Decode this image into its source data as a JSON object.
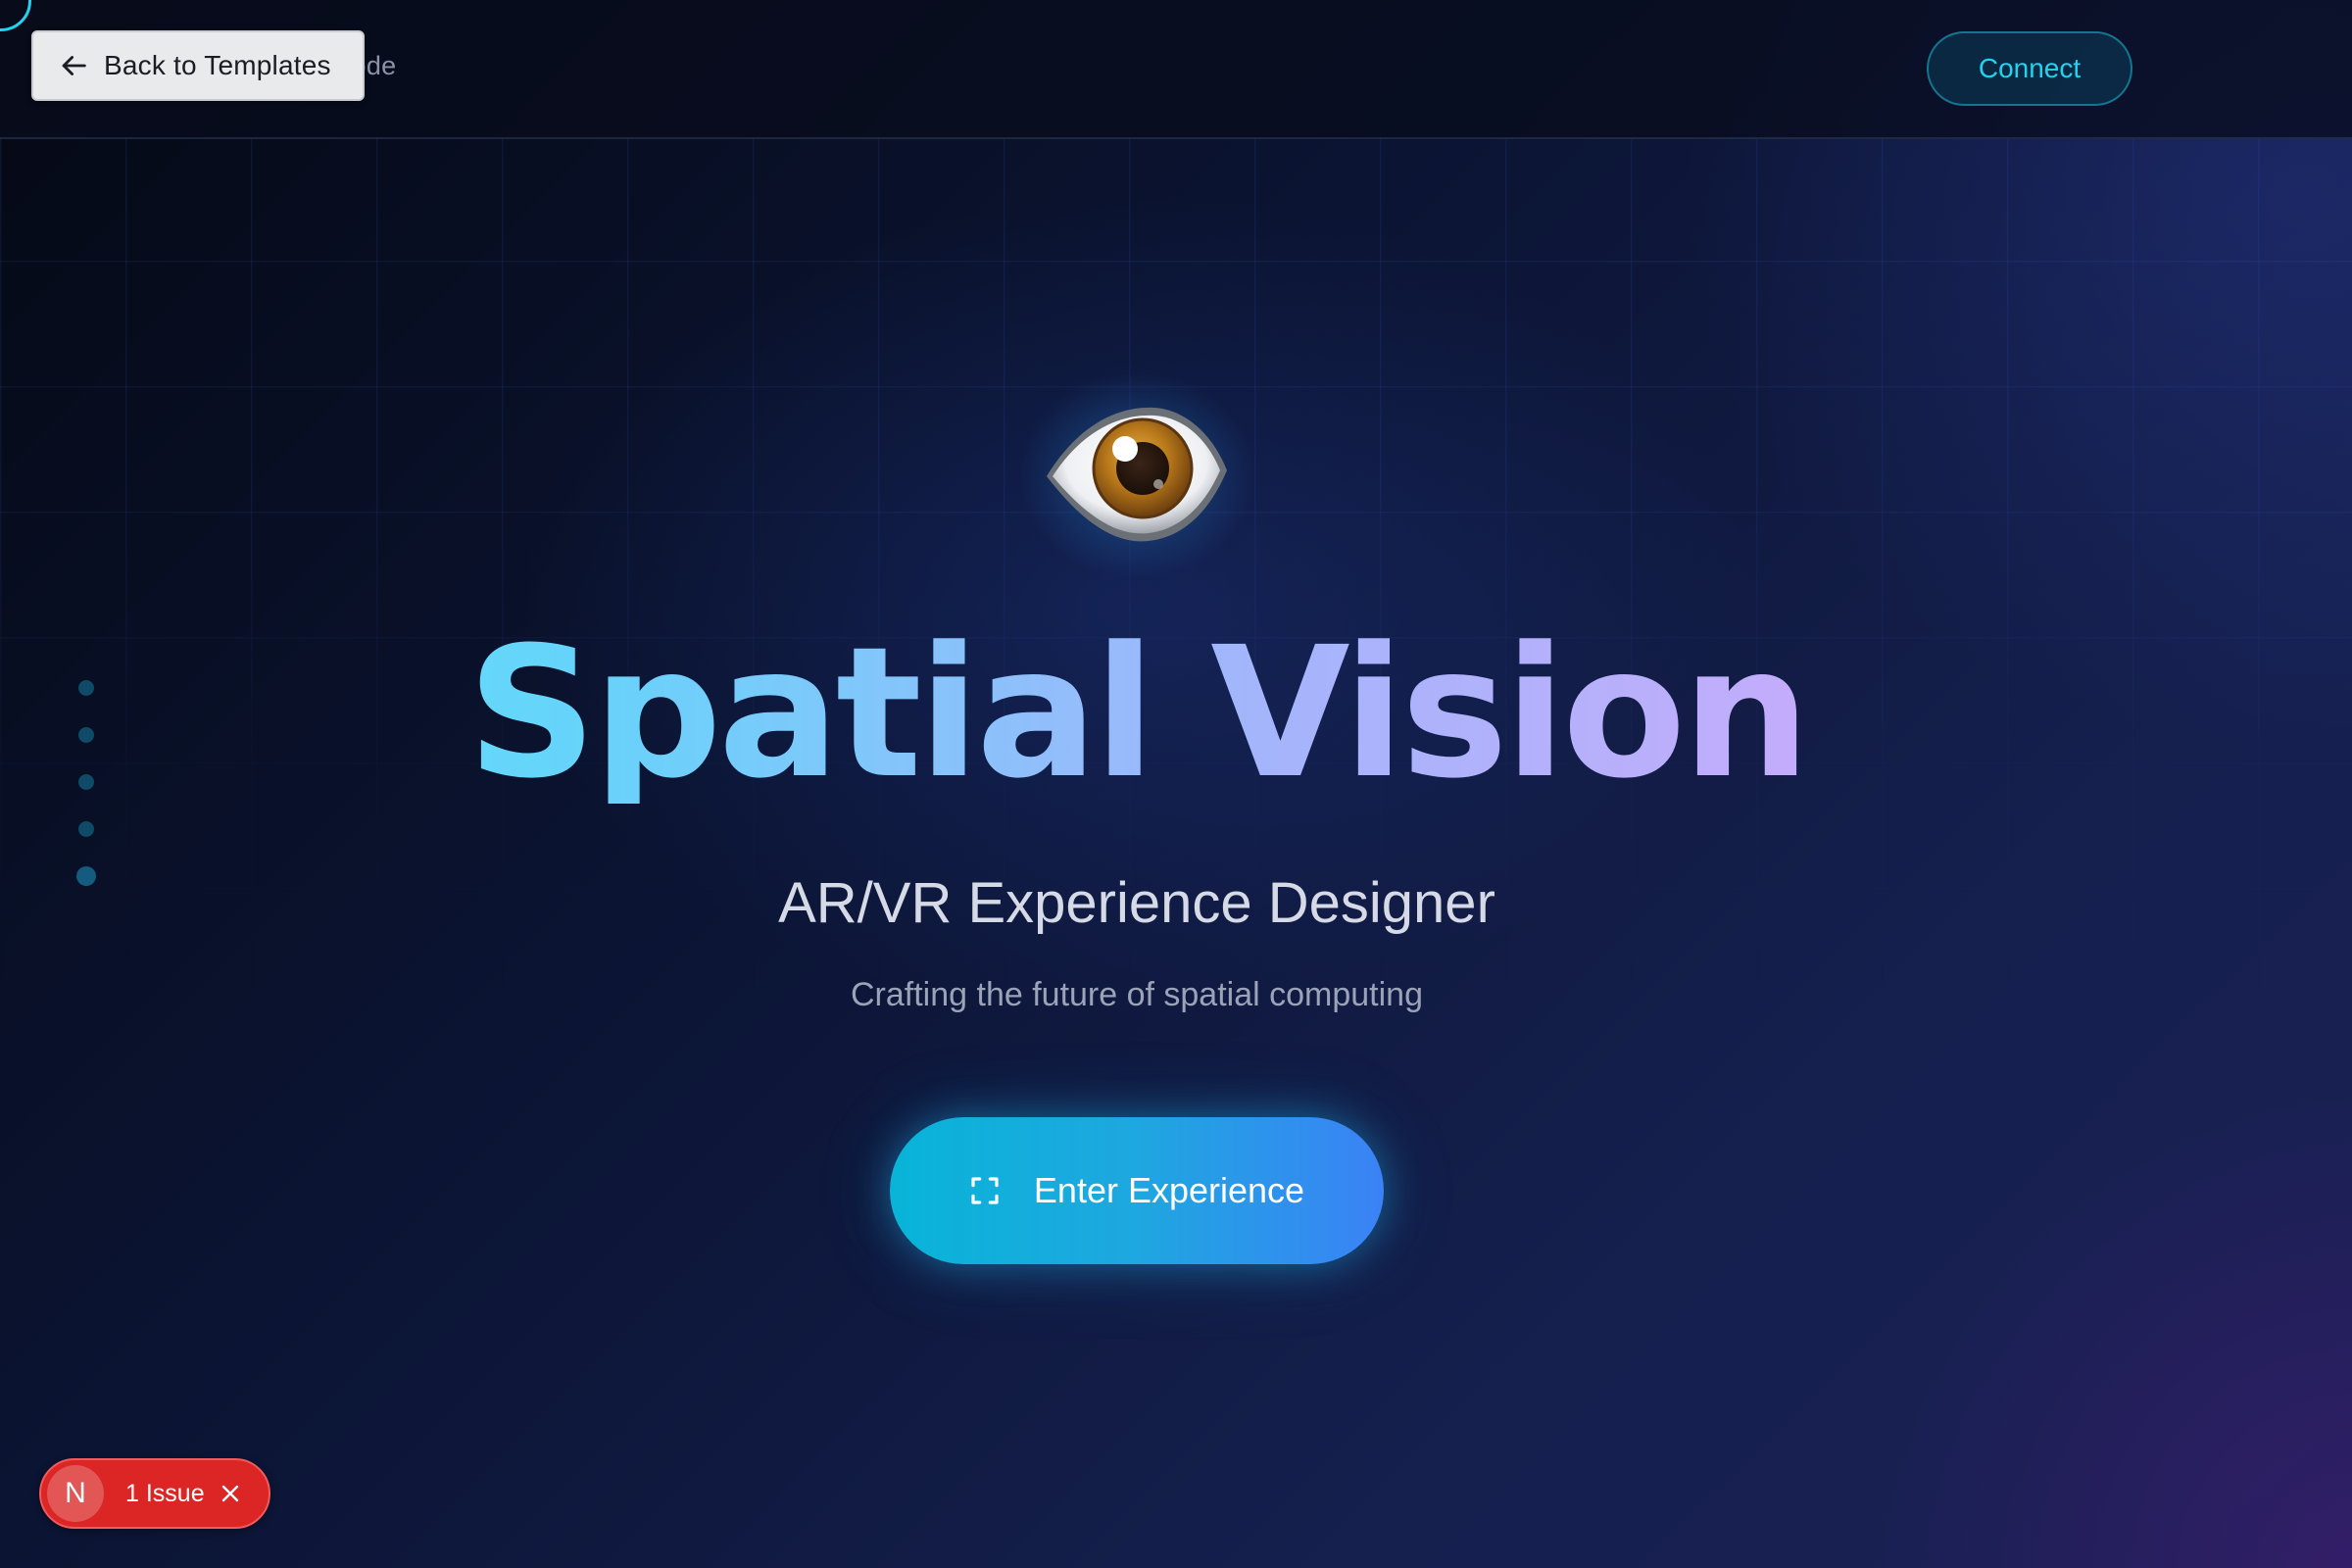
{
  "topbar": {
    "mode_label": "ial Mode",
    "back_label": "Back to Templates",
    "connect_label": "Connect"
  },
  "hero": {
    "icon": "eye-emoji",
    "title": "Spatial Vision",
    "subtitle": "AR/VR Experience Designer",
    "tagline": "Crafting the future of spatial computing",
    "cta_label": "Enter Experience",
    "cta_icon": "fullscreen-icon"
  },
  "side_nav": {
    "dots": 5,
    "active_index": 4
  },
  "dev_overlay": {
    "badge_letter": "N",
    "issue_label": "1 Issue"
  },
  "colors": {
    "accent_cyan": "#22d3ee",
    "title_gradient_start": "#5ee8fb",
    "title_gradient_end": "#dcb2fc",
    "cta_gradient_start": "#08b4d8",
    "cta_gradient_end": "#3b82f6",
    "issue_red": "#dc2626"
  }
}
